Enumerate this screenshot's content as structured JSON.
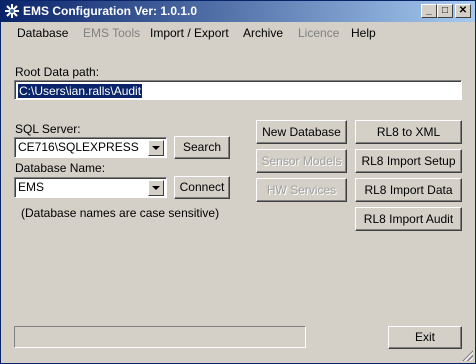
{
  "window": {
    "title": "EMS Configuration Ver: 1.0.1.0",
    "minimize_glyph": "_",
    "maximize_glyph": "□",
    "close_glyph": "✕"
  },
  "menu": {
    "items": [
      {
        "label": "Database",
        "enabled": true
      },
      {
        "label": "EMS Tools",
        "enabled": false
      },
      {
        "label": "Import / Export",
        "enabled": true
      },
      {
        "label": "Archive",
        "enabled": true
      },
      {
        "label": "Licence",
        "enabled": false
      },
      {
        "label": "Help",
        "enabled": true
      }
    ]
  },
  "root_path": {
    "label": "Root Data path:",
    "value": "C:\\Users\\ian.ralls\\Audit"
  },
  "sql_server": {
    "label": "SQL Server:",
    "value": "CE716\\SQLEXPRESS",
    "search_label": "Search"
  },
  "database": {
    "label": "Database Name:",
    "value": "EMS",
    "connect_label": "Connect",
    "note": "(Database names are case sensitive)"
  },
  "actions": {
    "new_database": "New Database",
    "sensor_models": "Sensor Models",
    "hw_services": "HW Services",
    "rl8_to_xml": "RL8 to XML",
    "rl8_import_setup": "RL8 Import Setup",
    "rl8_import_data": "RL8 Import Data",
    "rl8_import_audit": "RL8 Import Audit"
  },
  "footer": {
    "exit_label": "Exit",
    "progress": 0
  }
}
